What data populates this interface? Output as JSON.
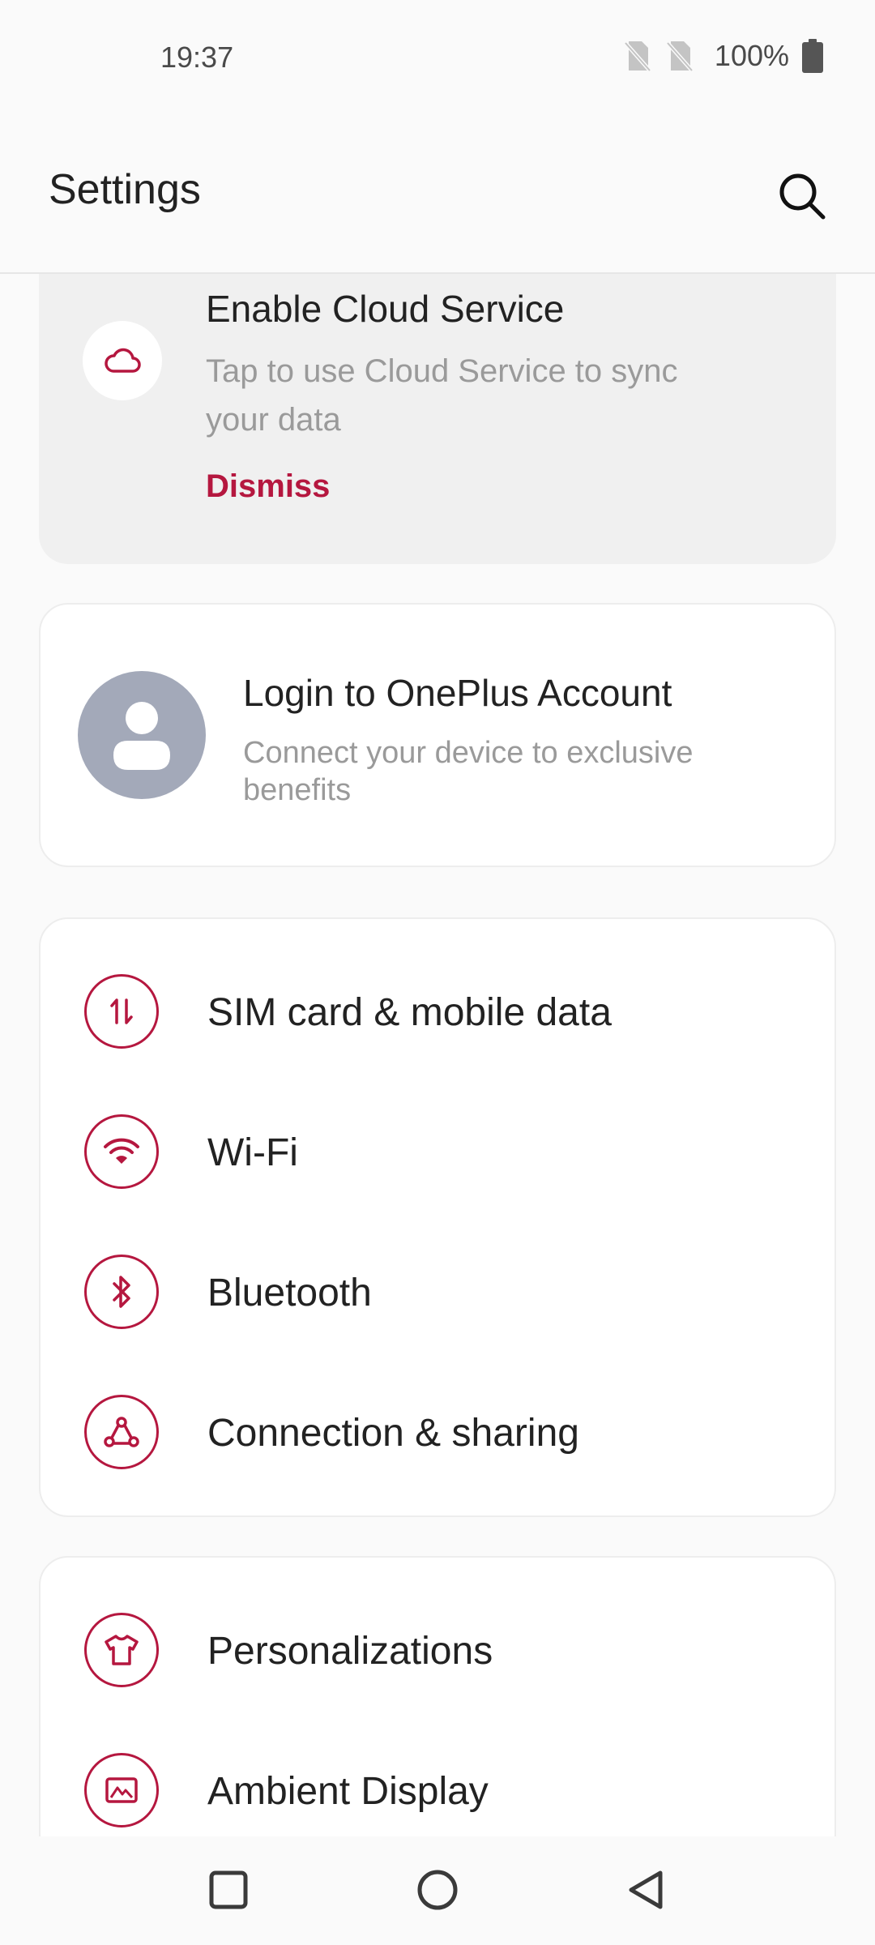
{
  "status_bar": {
    "time": "19:37",
    "battery": "100%",
    "icons": [
      "no-sim-icon",
      "no-sim-icon",
      "battery-icon"
    ]
  },
  "app_bar": {
    "title": "Settings",
    "search_icon": "search-icon"
  },
  "cloud_card": {
    "icon": "cloud-icon",
    "title": "Enable Cloud Service",
    "subtitle": "Tap to use Cloud Service to sync your data",
    "dismiss_label": "Dismiss"
  },
  "account_card": {
    "icon": "avatar-icon",
    "title": "Login to OnePlus Account",
    "subtitle": "Connect your device to exclusive benefits"
  },
  "group1": {
    "items": [
      {
        "label": "SIM card & mobile data",
        "icon": "mobile-data-icon"
      },
      {
        "label": "Wi-Fi",
        "icon": "wifi-icon"
      },
      {
        "label": "Bluetooth",
        "icon": "bluetooth-icon"
      },
      {
        "label": "Connection & sharing",
        "icon": "connection-sharing-icon"
      }
    ]
  },
  "group2": {
    "items": [
      {
        "label": "Personalizations",
        "icon": "tshirt-icon"
      },
      {
        "label": "Ambient Display",
        "icon": "ambient-display-icon"
      }
    ]
  },
  "nav_bar": {
    "icons": [
      "recents-icon",
      "home-icon",
      "back-icon"
    ]
  },
  "colors": {
    "accent": "#b5173f",
    "background": "#fafafa",
    "card": "#ffffff",
    "banner": "#f0f0f0",
    "avatar": "#a3a9b9",
    "secondary_text": "#9a9a9a"
  }
}
